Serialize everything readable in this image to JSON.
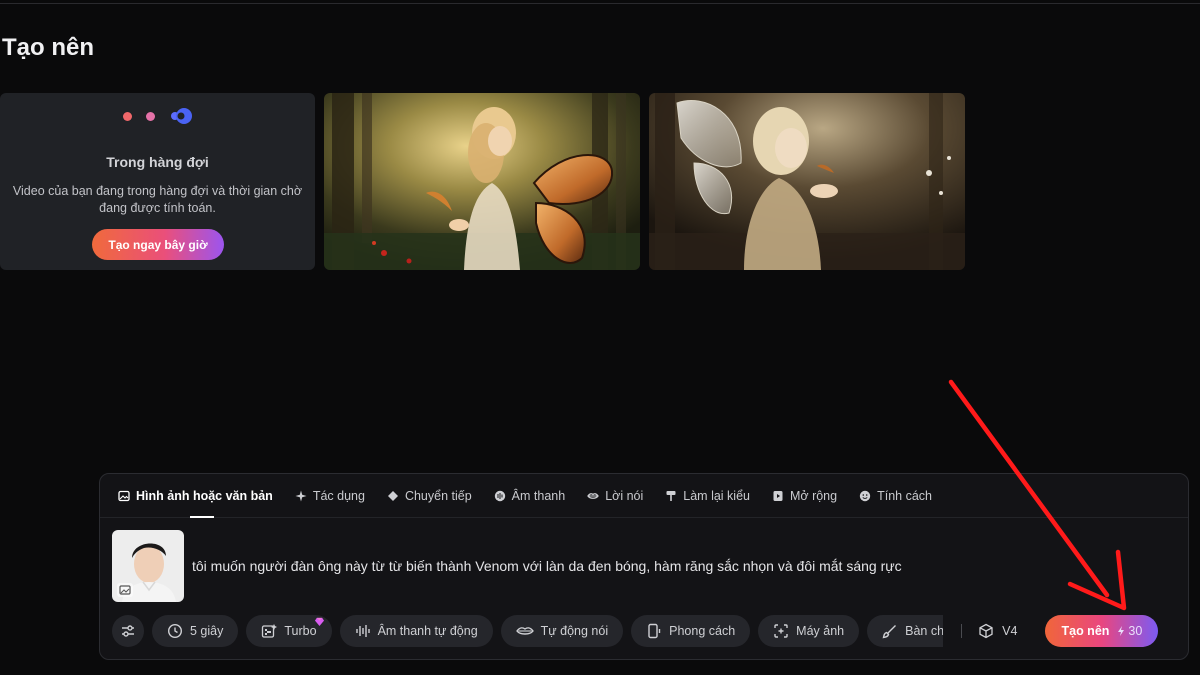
{
  "page_title": "Tạo nên",
  "queue_card": {
    "title": "Trong hàng đợi",
    "description": "Video của bạn đang trong hàng đợi và thời gian chờ đang được tính toán.",
    "cta_label": "Tạo ngay bây giờ"
  },
  "tabs": [
    {
      "label": "Hình ảnh hoặc văn bản",
      "icon": "image-icon",
      "active": true
    },
    {
      "label": "Tác dụng",
      "icon": "sparkle-icon"
    },
    {
      "label": "Chuyển tiếp",
      "icon": "diamond-icon"
    },
    {
      "label": "Âm thanh",
      "icon": "audio-icon"
    },
    {
      "label": "Lời nói",
      "icon": "lips-icon"
    },
    {
      "label": "Làm lại kiểu",
      "icon": "paint-roller-icon"
    },
    {
      "label": "Mở rộng",
      "icon": "expand-icon"
    },
    {
      "label": "Tính cách",
      "icon": "smiley-icon"
    }
  ],
  "prompt_text": "tôi muốn người đàn ông này từ từ biến thành Venom với làn da đen bóng, hàm răng sắc nhọn và đôi mắt sáng rực",
  "toolbar": {
    "duration": "5 giây",
    "turbo": "Turbo",
    "auto_audio": "Âm thanh tự động",
    "auto_speak": "Tự động nói",
    "style": "Phong cách",
    "camera": "Máy ảnh",
    "brush": "Bàn chải",
    "version": "V4",
    "create_label": "Tạo nên",
    "credits": "30"
  },
  "colors": {
    "background": "#0a0a0b",
    "card": "#202226",
    "accent_start": "#f0663a",
    "accent_mid": "#e9467f",
    "accent_end": "#7c5bf2",
    "annotation_arrow": "#ff1a1a"
  }
}
